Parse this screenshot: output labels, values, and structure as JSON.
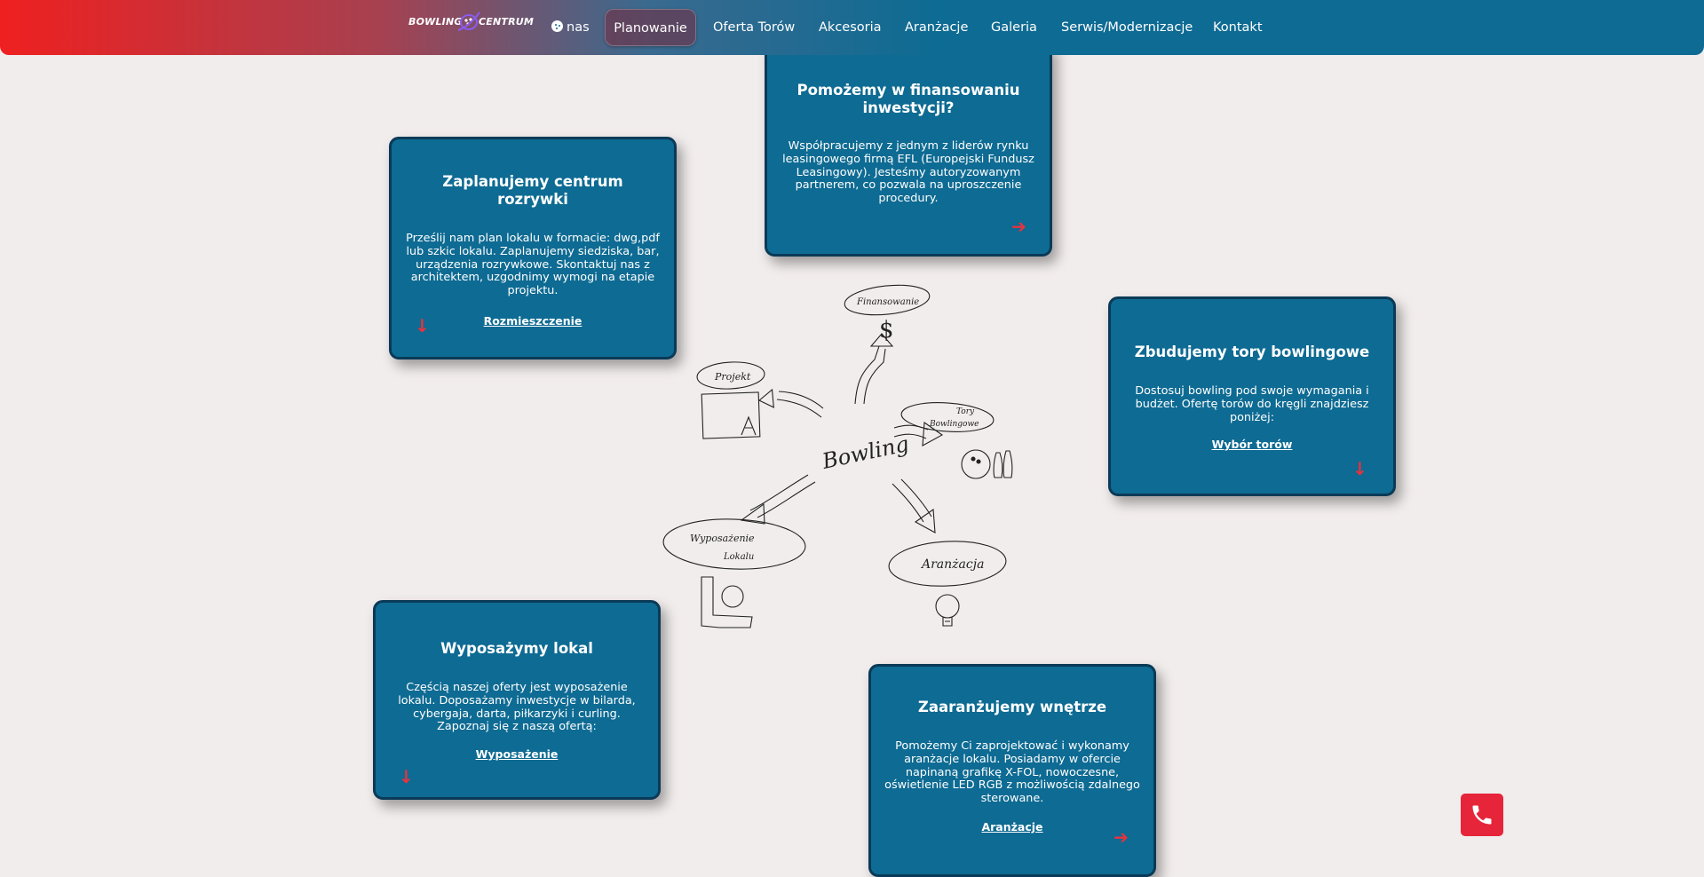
{
  "header": {
    "logo_text_left": "BOWLING",
    "logo_text_right": "CENTRUM",
    "nav": [
      {
        "label": "nas"
      },
      {
        "label": "Planowanie"
      },
      {
        "label": "Oferta Torów"
      },
      {
        "label": "Akcesoria"
      },
      {
        "label": "Aranżacje"
      },
      {
        "label": "Galeria"
      },
      {
        "label": "Serwis/Modernizacje"
      },
      {
        "label": "Kontakt"
      }
    ],
    "active_nav": "Planowanie"
  },
  "cards": {
    "financing": {
      "title": "Pomożemy w finansowaniu inwestycji?",
      "text": "Współpracujemy z jednym z liderów rynku leasingowego firmą EFL (Europejski Fundusz Leasingowy). Jesteśmy autoryzowanym partnerem, co pozwala na uproszczenie procedury."
    },
    "planning": {
      "title": "Zaplanujemy centrum rozrywki",
      "text": "Prześlij nam plan lokalu w formacie: dwg,pdf lub szkic lokalu. Zaplanujemy siedziska, bar, urządzenia rozrywkowe. Skontaktuj nas z architektem, uzgodnimy wymogi na etapie projektu.",
      "link": "Rozmieszczenie"
    },
    "lanes": {
      "title": "Zbudujemy tory bowlingowe",
      "text": "Dostosuj bowling pod swoje wymagania i budżet. Ofertę torów do kręgli znajdziesz poniżej:",
      "link": "Wybór torów"
    },
    "equipment": {
      "title": "Wyposażymy lokal",
      "text": "Częścią naszej oferty jest wyposażenie lokalu. Doposażamy inwestycje w bilarda, cybergaja, darta, piłkarzyki i curling.",
      "text2": "Zapoznaj się z naszą ofertą:",
      "link": "Wyposażenie"
    },
    "interior": {
      "title": "Zaaranżujemy wnętrze",
      "text": "Pomożemy Ci zaprojektować i wykonamy aranżacje lokalu. Posiadamy w ofercie napinaną grafikę X-FOL, nowoczesne, oświetlenie LED RGB z możliwością zdalnego sterowane.",
      "link": "Aranżacje"
    }
  },
  "sketch": {
    "center": "Bowling",
    "finance": "Finansowanie",
    "project": "Projekt",
    "lanes_line1": "Tory",
    "lanes_line2": "Bowlingowe",
    "equipment_line1": "Wyposażenie",
    "equipment_line2": "Lokalu",
    "arrangement": "Aranżacja"
  },
  "icons": {
    "cookie": "cookie-icon",
    "arrow_right": "arrow-right-icon",
    "arrow_down": "arrow-down-icon",
    "phone": "phone-icon"
  },
  "colors": {
    "card_bg": "#0e6b93",
    "card_border": "#0a3a57",
    "accent_red": "#e8323c",
    "page_bg": "#f2eded"
  }
}
